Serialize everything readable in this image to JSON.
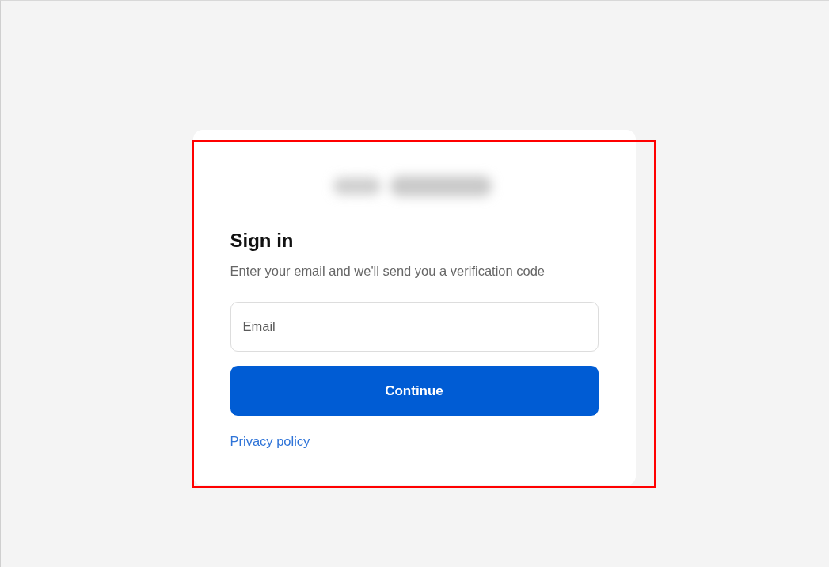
{
  "sign_in_card": {
    "title": "Sign in",
    "subtitle": "Enter your email and we'll send you a verification code",
    "email_field": {
      "placeholder": "Email"
    },
    "continue_button": {
      "label": "Continue"
    },
    "privacy_link": {
      "label": "Privacy policy"
    }
  }
}
